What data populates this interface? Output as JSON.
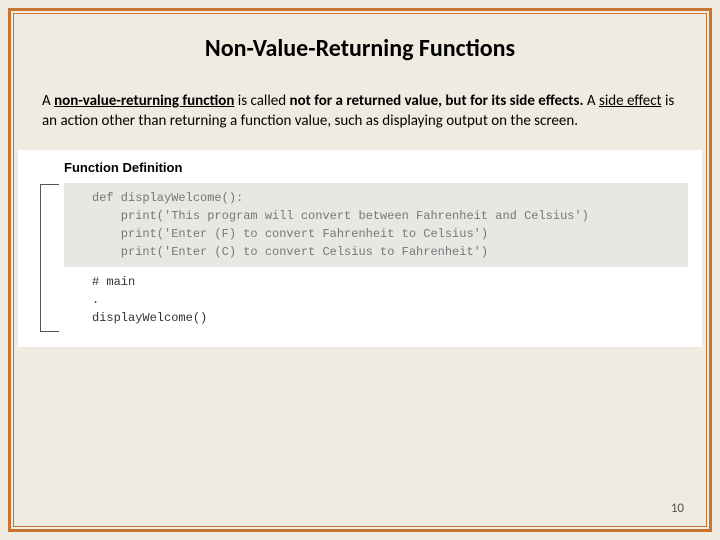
{
  "title": "Non-Value-Returning Functions",
  "paragraph": {
    "pre": "A ",
    "term1": "non-value-returning function",
    "mid1": " is called ",
    "bold_mid": "not for a returned value, but for its side effects.",
    "mid2": "  A ",
    "term2": "side effect",
    "tail": " is an action other than returning a function value, such as displaying output on the screen."
  },
  "figure": {
    "label": "Function Definition",
    "def_code": "def displayWelcome():\n    print('This program will convert between Fahrenheit and Celsius')\n    print('Enter (F) to convert Fahrenheit to Celsius')\n    print('Enter (C) to convert Celsius to Fahrenheit')",
    "main_code": "# main\n.\ndisplayWelcome()"
  },
  "page_number": "10"
}
